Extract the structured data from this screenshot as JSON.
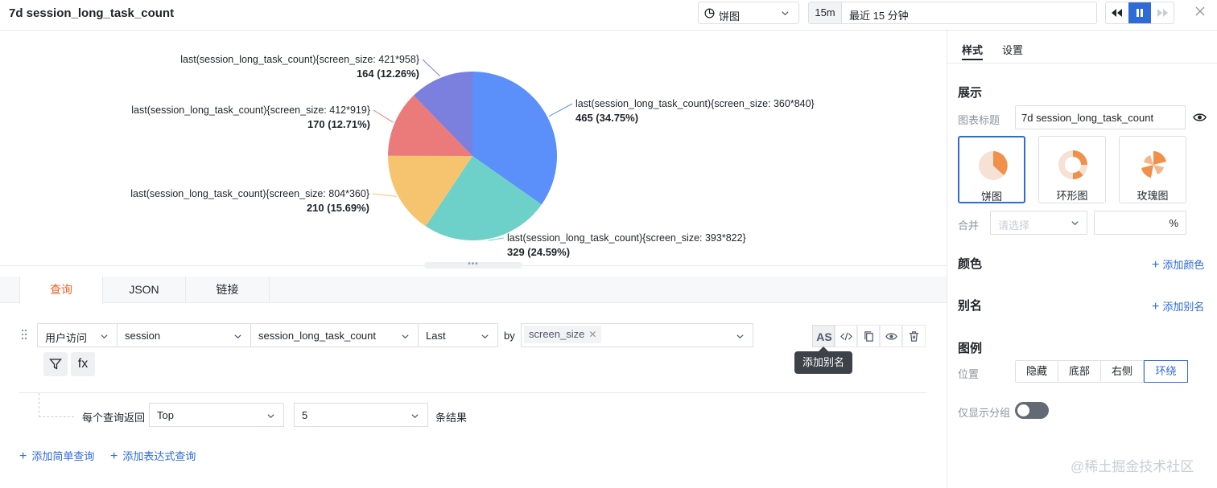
{
  "header": {
    "title": "7d session_long_task_count",
    "chart_type": "饼图",
    "quick_range": "15m",
    "time_range": "最近 15 分钟"
  },
  "chart_data": {
    "type": "pie",
    "slices": [
      {
        "label": "last(session_long_task_count){screen_size: 360*840}",
        "value": 465,
        "percent": "34.75%",
        "color": "#5b8ff9"
      },
      {
        "label": "last(session_long_task_count){screen_size: 393*822}",
        "value": 329,
        "percent": "24.59%",
        "color": "#6dd1c9"
      },
      {
        "label": "last(session_long_task_count){screen_size: 804*360}",
        "value": 210,
        "percent": "15.69%",
        "color": "#f6c46f"
      },
      {
        "label": "last(session_long_task_count){screen_size: 412*919}",
        "value": 170,
        "percent": "12.71%",
        "color": "#eb7b7b"
      },
      {
        "label": "last(session_long_task_count){screen_size: 421*958}",
        "value": 164,
        "percent": "12.26%",
        "color": "#7b7fdd"
      }
    ],
    "legend": "around"
  },
  "query_tabs": [
    "查询",
    "JSON",
    "链接"
  ],
  "query": {
    "source": "用户访问",
    "category": "session",
    "metric": "session_long_task_count",
    "aggregation": "Last",
    "by_label": "by",
    "group_tag": "screen_size",
    "as_label": "AS",
    "fx_label": "fx",
    "tooltip": "添加别名",
    "each_return_label": "每个查询返回",
    "limit_type": "Top",
    "limit_value": "5",
    "results_label": "条结果",
    "add_simple": "添加简单查询",
    "add_expression": "添加表达式查询"
  },
  "panel": {
    "tabs": [
      "样式",
      "设置"
    ],
    "display_heading": "展示",
    "title_label": "图表标题",
    "title_value": "7d session_long_task_count",
    "types": [
      "饼图",
      "环形图",
      "玫瑰图"
    ],
    "merge_label": "合并",
    "merge_placeholder": "请选择",
    "percent_sign": "%",
    "color_heading": "颜色",
    "add_color": "添加颜色",
    "alias_heading": "别名",
    "add_alias": "添加别名",
    "legend_heading": "图例",
    "position_label": "位置",
    "positions": [
      "隐藏",
      "底部",
      "右侧",
      "环绕"
    ],
    "group_only_label": "仅显示分组"
  },
  "watermark": "@稀土掘金技术社区",
  "colors": {
    "accent": "#2f6bd7",
    "active_tab": "#e8622c",
    "pie_icon": "#f0904a"
  }
}
